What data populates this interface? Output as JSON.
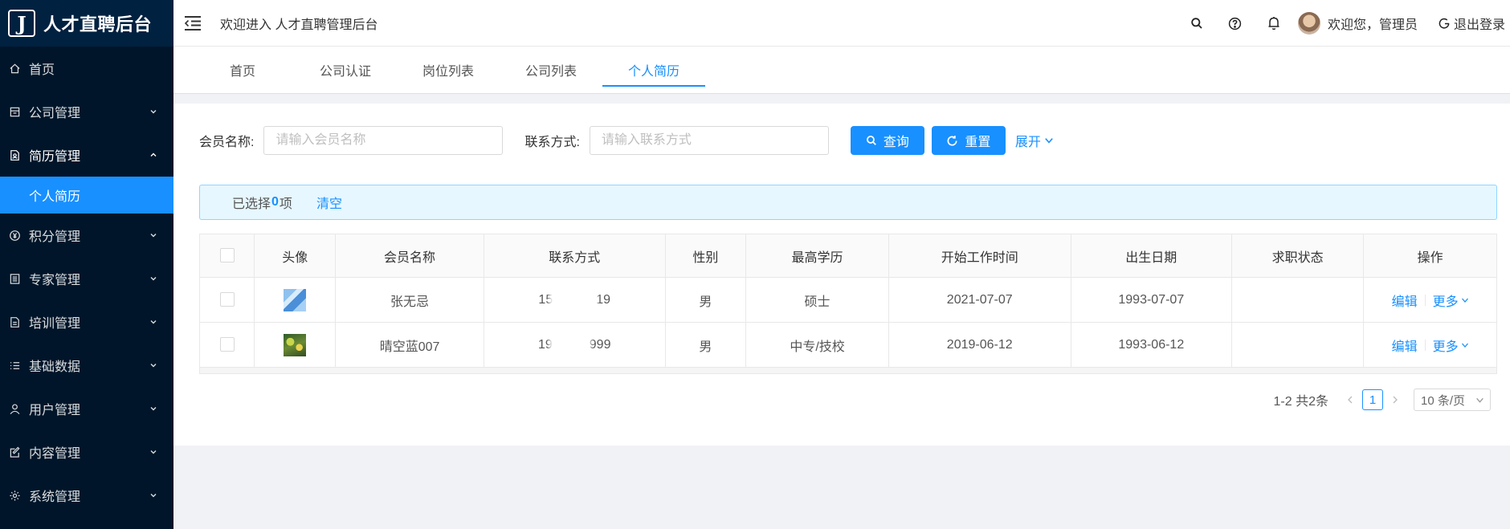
{
  "app": {
    "logo_mark": "J",
    "title": "人才直聘后台"
  },
  "sidebar": {
    "items": [
      {
        "label": "首页",
        "icon": "home-icon",
        "has_children": false
      },
      {
        "label": "公司管理",
        "icon": "building-icon",
        "has_children": true,
        "expanded": false
      },
      {
        "label": "简历管理",
        "icon": "resume-icon",
        "has_children": true,
        "expanded": true,
        "children": [
          {
            "label": "个人简历",
            "active": true
          }
        ]
      },
      {
        "label": "积分管理",
        "icon": "yen-icon",
        "has_children": true,
        "expanded": false
      },
      {
        "label": "专家管理",
        "icon": "list-doc-icon",
        "has_children": true,
        "expanded": false
      },
      {
        "label": "培训管理",
        "icon": "file-icon",
        "has_children": true,
        "expanded": false
      },
      {
        "label": "基础数据",
        "icon": "bullet-list-icon",
        "has_children": true,
        "expanded": false
      },
      {
        "label": "用户管理",
        "icon": "user-icon",
        "has_children": true,
        "expanded": false
      },
      {
        "label": "内容管理",
        "icon": "edit-icon",
        "has_children": true,
        "expanded": false
      },
      {
        "label": "系统管理",
        "icon": "gear-icon",
        "has_children": true,
        "expanded": false
      }
    ]
  },
  "header": {
    "welcome": "欢迎进入 人才直聘管理后台",
    "user_greeting": "欢迎您，管理员",
    "logout": "退出登录",
    "icons": [
      "search-icon",
      "help-icon",
      "bell-icon"
    ]
  },
  "tabs": [
    {
      "label": "首页",
      "active": false
    },
    {
      "label": "公司认证",
      "active": false
    },
    {
      "label": "岗位列表",
      "active": false
    },
    {
      "label": "公司列表",
      "active": false
    },
    {
      "label": "个人简历",
      "active": true
    }
  ],
  "search": {
    "member_label": "会员名称:",
    "member_placeholder": "请输入会员名称",
    "member_value": "",
    "contact_label": "联系方式:",
    "contact_placeholder": "请输入联系方式",
    "contact_value": "",
    "query_button": "查询",
    "reset_button": "重置",
    "expand_link": "展开"
  },
  "selection": {
    "prefix": "已选择",
    "count": "0",
    "suffix": "项",
    "clear": "清空"
  },
  "table": {
    "columns": [
      "头像",
      "会员名称",
      "联系方式",
      "性别",
      "最高学历",
      "开始工作时间",
      "出生日期",
      "求职状态",
      "操作"
    ],
    "rows": [
      {
        "avatar": "avatar-thumb-blue",
        "name": "张无忌",
        "phone_start": "15",
        "phone_end": "19",
        "gender": "男",
        "education": "硕士",
        "start_work": "2021-07-07",
        "birth": "1993-07-07",
        "status": ""
      },
      {
        "avatar": "avatar-thumb-flowers",
        "name": "晴空蓝007",
        "phone_start": "19",
        "phone_end": "999",
        "gender": "男",
        "education": "中专/技校",
        "start_work": "2019-06-12",
        "birth": "1993-06-12",
        "status": ""
      }
    ],
    "action_edit": "编辑",
    "action_more": "更多"
  },
  "pagination": {
    "total_text": "1-2 共2条",
    "current_page": "1",
    "page_size": "10 条/页"
  },
  "colors": {
    "primary": "#1890ff",
    "sidebar_bg": "#001529",
    "alert_bg": "#e6f7ff"
  }
}
